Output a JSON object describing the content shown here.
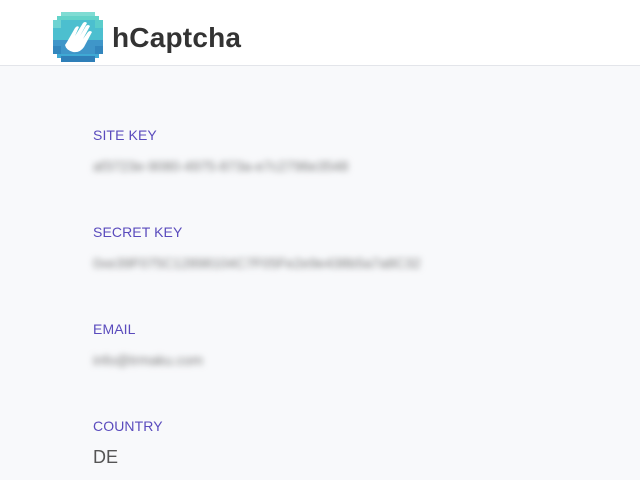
{
  "header": {
    "brand": "hCaptcha",
    "logo_icon": "hcaptcha-hand-logo-icon",
    "colors": {
      "logo_light": "#63d3c9",
      "logo_mid": "#3fa9d4",
      "logo_dark": "#2f7fb8"
    }
  },
  "fields": {
    "site_key": {
      "label": "SITE KEY",
      "value": "af3723e-9080-4975-873a-e7c2796e3548"
    },
    "secret_key": {
      "label": "SECRET KEY",
      "value": "0xe39F075C12898104C7F05Fe2e9e438b5a7a8C32"
    },
    "email": {
      "label": "EMAIL",
      "value": "info@trmaku.com"
    },
    "country": {
      "label": "COUNTRY",
      "value": "DE"
    }
  },
  "colors": {
    "label": "#5a4bbd",
    "background": "#f8f9fb"
  }
}
